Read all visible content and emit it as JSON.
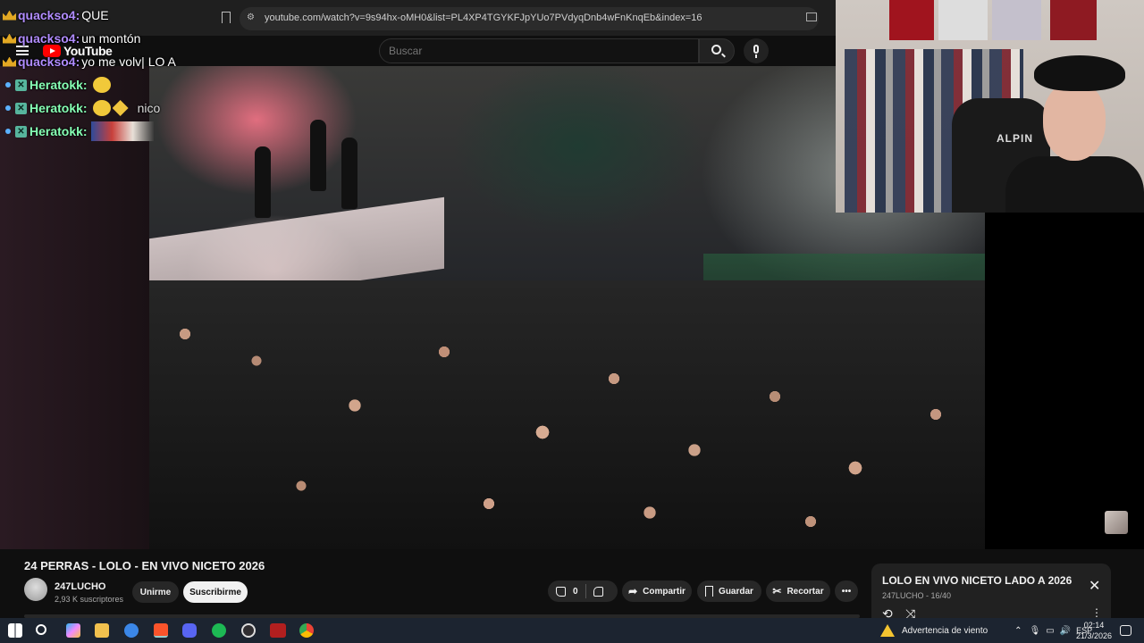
{
  "browser": {
    "url": "youtube.com/watch?v=9s94hx-oMH0&list=PL4XP4TGYKFJpYUo7PVdyqDnb4wFnKnqEb&index=16"
  },
  "youtube": {
    "logo_text": "YouTube",
    "search_placeholder": "Buscar"
  },
  "chat": [
    {
      "user": "quacksо4",
      "message": "QUE",
      "badge": "crown"
    },
    {
      "user": "quacksо4",
      "message": "un montón",
      "badge": "crown"
    },
    {
      "user": "quacksо4",
      "message": "yo me volv| LO A",
      "badge": "crown"
    },
    {
      "user": "Heratokk",
      "message": "",
      "badge": "x",
      "emote": "yellow-emote"
    },
    {
      "user": "Heratokk",
      "message": "nico",
      "badge": "x",
      "emote": "face-emote"
    },
    {
      "user": "Heratokk",
      "message": "",
      "badge": "x",
      "emote": "image-emote"
    }
  ],
  "webcam": {
    "chair_label": "ALPIN"
  },
  "video": {
    "title": "24 PERRAS - LOLO - EN VIVO NICETO 2026",
    "channel": "247LUCHO",
    "subscribers": "2,93 K suscriptores",
    "join_label": "Unirme",
    "subscribe_label": "Suscribirme",
    "like_count": "0",
    "share_label": "Compartir",
    "save_label": "Guardar",
    "clip_label": "Recortar"
  },
  "playlist": {
    "title": "LOLO EN VIVO NICETO LADO A 2026",
    "subtitle": "247LUCHO - 16/40"
  },
  "taskbar": {
    "weather_alert": "Advertencia de viento",
    "language": "ESP",
    "time": "02:14",
    "date": "21/3/2026"
  },
  "colors": {
    "background": "#0f0f0f",
    "yt_red": "#ff0000",
    "chat_user_quack": "#b18cff",
    "chat_user_hera": "#86ffb4",
    "taskbar": "#1c2430"
  }
}
